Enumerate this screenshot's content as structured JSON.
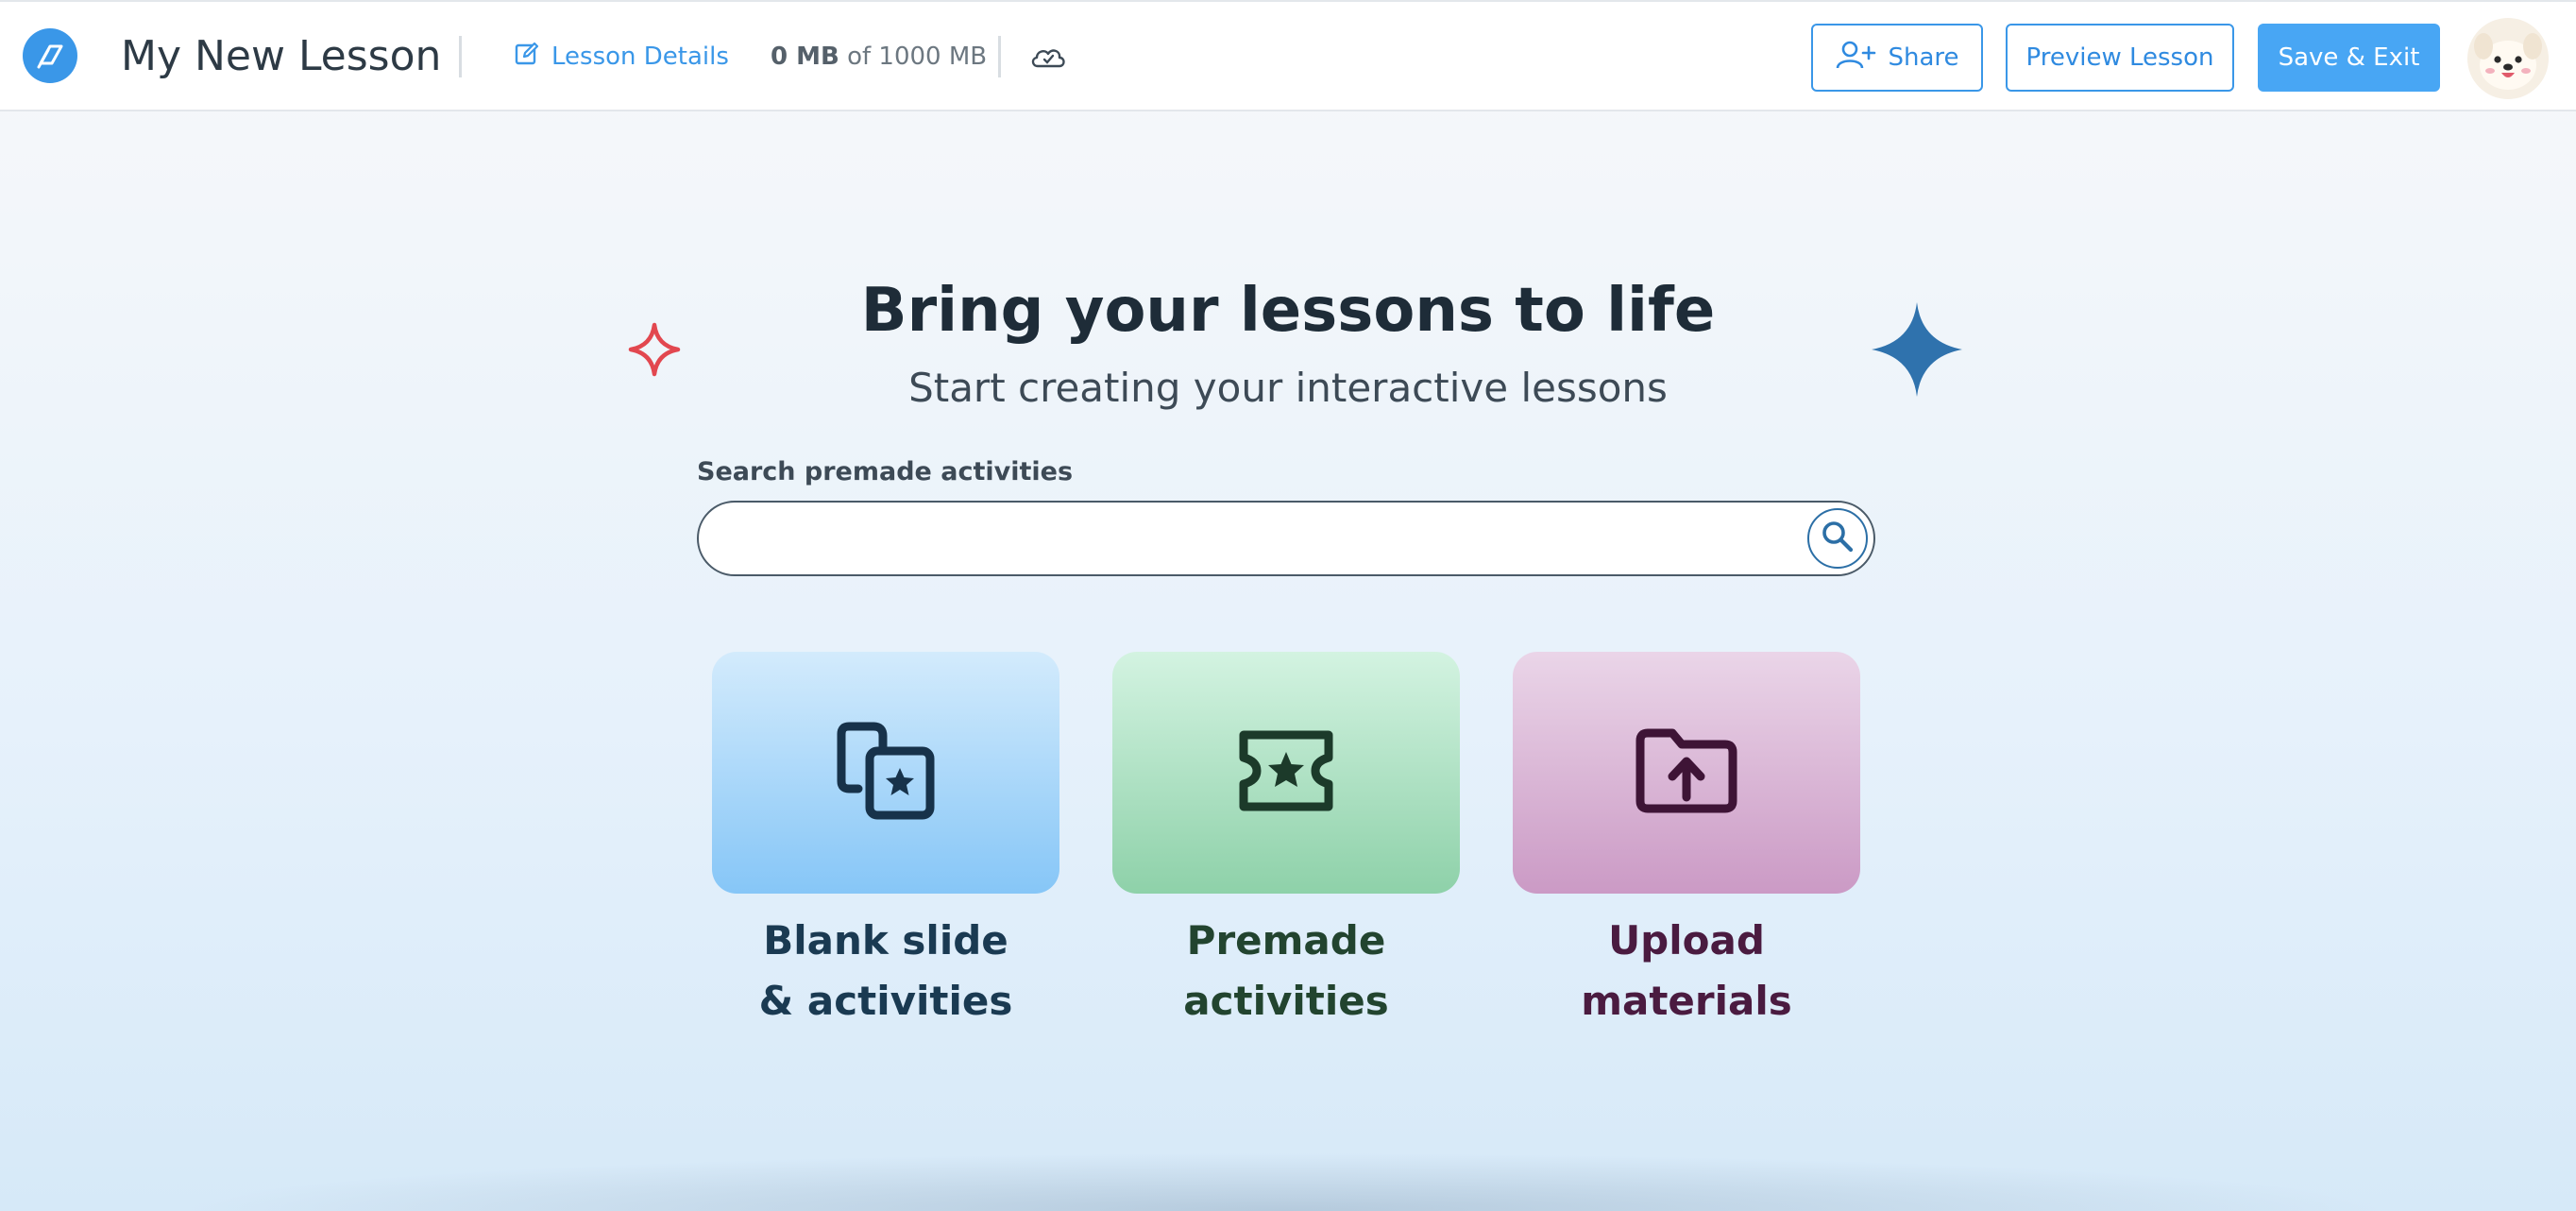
{
  "header": {
    "lesson_title": "My New Lesson",
    "lesson_details_label": "Lesson Details",
    "storage_used": "0 MB",
    "storage_total": "of 1000 MB",
    "share_label": "Share",
    "preview_label": "Preview Lesson",
    "save_exit_label": "Save & Exit"
  },
  "hero": {
    "title": "Bring your lessons to life",
    "subtitle": "Start creating your interactive lessons"
  },
  "search": {
    "label": "Search premade activities",
    "value": "",
    "placeholder": ""
  },
  "cards": [
    {
      "line1": "Blank slide",
      "line2": "& activities",
      "icon": "slides-star-icon"
    },
    {
      "line1": "Premade",
      "line2": "activities",
      "icon": "ticket-star-icon"
    },
    {
      "line1": "Upload",
      "line2": "materials",
      "icon": "folder-upload-icon"
    }
  ],
  "colors": {
    "accent": "#3a97e8",
    "primary_button": "#48a6f4",
    "sparkle_red": "#e2474f",
    "sparkle_blue": "#2f72ad",
    "card_blank": "#86c6f7",
    "card_premade": "#8ed1a9",
    "card_upload": "#cb9ac5"
  }
}
